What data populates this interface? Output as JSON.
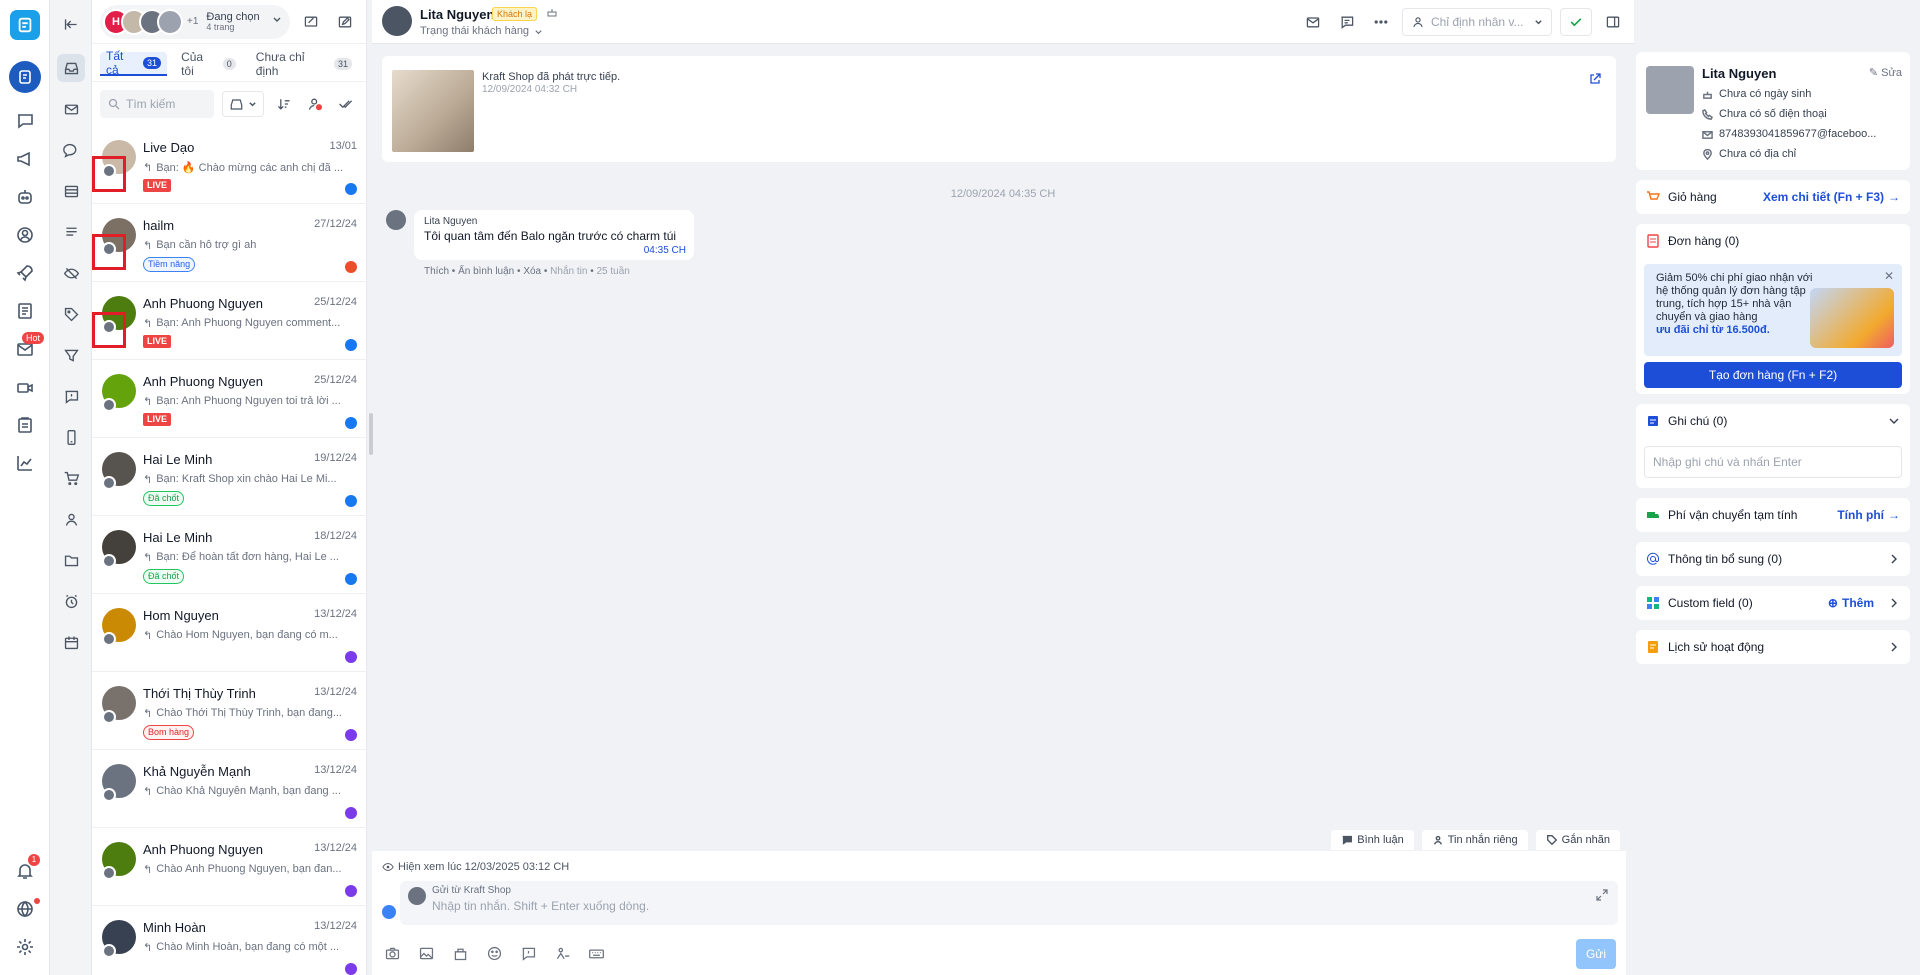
{
  "header": {
    "pages_label": "Đang chọn",
    "pages_count": "4 trang",
    "plus_count": "+1",
    "avatar_letter": "H"
  },
  "tabs": [
    {
      "label": "Tất cả",
      "count": "31"
    },
    {
      "label": "Của tôi",
      "count": "0"
    },
    {
      "label": "Chưa chỉ định",
      "count": "31"
    }
  ],
  "search": {
    "placeholder": "Tìm kiếm"
  },
  "conversations": [
    {
      "name": "Live Dạo",
      "date": "13/01",
      "msg": "Bạn: 🔥 Chào mừng các anh chị đã ...",
      "tag": "LIVE",
      "tag_type": "live",
      "source": "facebook",
      "highlighted": true
    },
    {
      "name": "hailm",
      "date": "27/12/24",
      "msg": "Bạn cần hỗ trợ gì ah",
      "tag": "Tiềm năng",
      "tag_type": "pot",
      "source": "shopee",
      "highlighted": true
    },
    {
      "name": "Anh Phuong Nguyen",
      "date": "25/12/24",
      "msg": "Bạn: Anh Phuong Nguyen comment...",
      "tag": "LIVE",
      "tag_type": "live",
      "source": "facebook",
      "highlighted": true
    },
    {
      "name": "Anh Phuong Nguyen",
      "date": "25/12/24",
      "msg": "Bạn: Anh Phuong Nguyen toi trả lời ...",
      "tag": "LIVE",
      "tag_type": "live",
      "source": "facebook",
      "highlighted": false
    },
    {
      "name": "Hai Le Minh",
      "date": "19/12/24",
      "msg": "Bạn: Kraft Shop xin chào Hai Le Mi...",
      "tag": "Đã chốt",
      "tag_type": "done",
      "source": "facebook",
      "highlighted": false
    },
    {
      "name": "Hai Le Minh",
      "date": "18/12/24",
      "msg": "Bạn: Để hoàn tất đơn hàng, Hai Le ...",
      "tag": "Đã chốt",
      "tag_type": "done",
      "source": "facebook",
      "highlighted": false
    },
    {
      "name": "Hom Nguyen",
      "date": "13/12/24",
      "msg": "Chào Hom Nguyen, bạn đang có m...",
      "tag": "",
      "tag_type": "",
      "source": "messenger",
      "highlighted": false
    },
    {
      "name": "Thới Thị Thùy Trinh",
      "date": "13/12/24",
      "msg": "Chào Thới Thị Thùy Trinh, bạn đang...",
      "tag": "Bom hàng",
      "tag_type": "bom",
      "source": "messenger",
      "highlighted": false
    },
    {
      "name": "Khả Nguyễn Mạnh",
      "date": "13/12/24",
      "msg": "Chào Khả Nguyễn Mạnh, bạn đang ...",
      "tag": "",
      "tag_type": "",
      "source": "messenger",
      "highlighted": false
    },
    {
      "name": "Anh Phuong Nguyen",
      "date": "13/12/24",
      "msg": "Chào Anh Phuong Nguyen, bạn đan...",
      "tag": "",
      "tag_type": "",
      "source": "messenger",
      "highlighted": false
    },
    {
      "name": "Minh Hoàn",
      "date": "13/12/24",
      "msg": "Chào Minh Hoàn, bạn đang có một ...",
      "tag": "",
      "tag_type": "",
      "source": "messenger",
      "highlighted": false
    }
  ],
  "chat": {
    "name": "Lita Nguyen",
    "customer_tag": "Khách lạ",
    "status": "Trạng thái khách hàng",
    "assign_placeholder": "Chỉ định nhân v...",
    "post_text": "Kraft Shop đã phát trực tiếp.",
    "post_time": "12/09/2024 04:32 CH",
    "date_sep": "12/09/2024 04:35 CH",
    "msg_sender": "Lita Nguyen",
    "msg_text": "Tôi quan tâm đến Balo ngăn trước có charm túi",
    "msg_time": "04:35 CH",
    "act_like": "Thích",
    "act_hide": "Ẩn bình luận",
    "act_delete": "Xóa",
    "act_dm": "Nhắn tin",
    "act_age": "25 tuần",
    "mode_comment": "Bình luận",
    "mode_private": "Tin nhắn riêng",
    "mode_tag": "Gắn nhãn",
    "seen": "Hiện xem lúc 12/03/2025 03:12 CH",
    "send_from": "Gửi từ Kraft Shop",
    "input_placeholder": "Nhập tin nhắn. Shift + Enter xuống dòng.",
    "send_label": "Gửi"
  },
  "profile": {
    "name": "Lita Nguyen",
    "edit": "Sửa",
    "birthday": "Chưa có ngày sinh",
    "phone": "Chưa có số điện thoại",
    "email": "8748393041859677@faceboo...",
    "address": "Chưa có địa chỉ"
  },
  "panels": {
    "cart_label": "Giỏ hàng",
    "cart_link": "Xem chi tiết (Fn + F3)",
    "order_label": "Đơn hàng (0)",
    "promo_text": "Giảm 50% chi phí giao nhận với hệ thống quản lý đơn hàng tập trung, tích hợp 15+ nhà vận chuyển và giao hàng",
    "promo_strong": "ưu đãi chỉ từ 16.500đ.",
    "order_btn": "Tạo đơn hàng (Fn + F2)",
    "note_label": "Ghi chú (0)",
    "note_placeholder": "Nhập ghi chú và nhấn Enter",
    "ship_label": "Phí vận chuyển tạm tính",
    "ship_link": "Tính phí",
    "extra_label": "Thông tin bổ sung (0)",
    "custom_label": "Custom field (0)",
    "custom_link": "Thêm",
    "history_label": "Lịch sử hoạt động"
  },
  "rail": {
    "hot_label": "Hot",
    "notif_count": "1"
  },
  "colors": {
    "primary": "#1d4ed8",
    "live": "#ef4444",
    "highlight": "#e11d27",
    "facebook": "#1877f2",
    "messenger": "#7c3aed",
    "shopee": "#ee4d2d"
  }
}
